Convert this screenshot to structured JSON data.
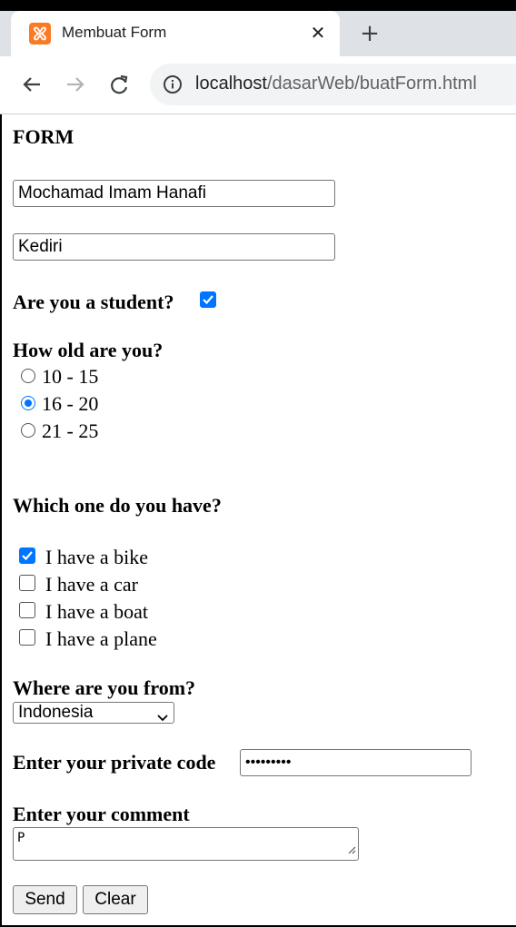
{
  "browser": {
    "tab": {
      "title": "Membuat Form",
      "favicon": "xampp-icon"
    },
    "url": {
      "host": "localhost",
      "path": "/dasarWeb/buatForm.html"
    }
  },
  "form": {
    "title": "FORM",
    "name_value": "Mochamad Imam Hanafi",
    "city_value": "Kediri",
    "student_question": "Are you a student?",
    "student_checked": true,
    "age_question": "How old are you?",
    "age_options": [
      {
        "label": "10 - 15",
        "checked": false
      },
      {
        "label": "16 - 20",
        "checked": true
      },
      {
        "label": "21 - 25",
        "checked": false
      }
    ],
    "vehicle_question": "Which one do you have?",
    "vehicle_options": [
      {
        "label": "I have a bike",
        "checked": true
      },
      {
        "label": "I have a car",
        "checked": false
      },
      {
        "label": "I have a boat",
        "checked": false
      },
      {
        "label": "I have a plane",
        "checked": false
      }
    ],
    "country_question": "Where are you from?",
    "country_selected": "Indonesia",
    "code_label": "Enter your private code",
    "code_masked": "•••••••••",
    "comment_label": "Enter your comment",
    "comment_value": "P",
    "send_label": "Send",
    "clear_label": "Clear"
  },
  "colors": {
    "accent": "#0075ff",
    "favicon": "#fb7a24"
  }
}
